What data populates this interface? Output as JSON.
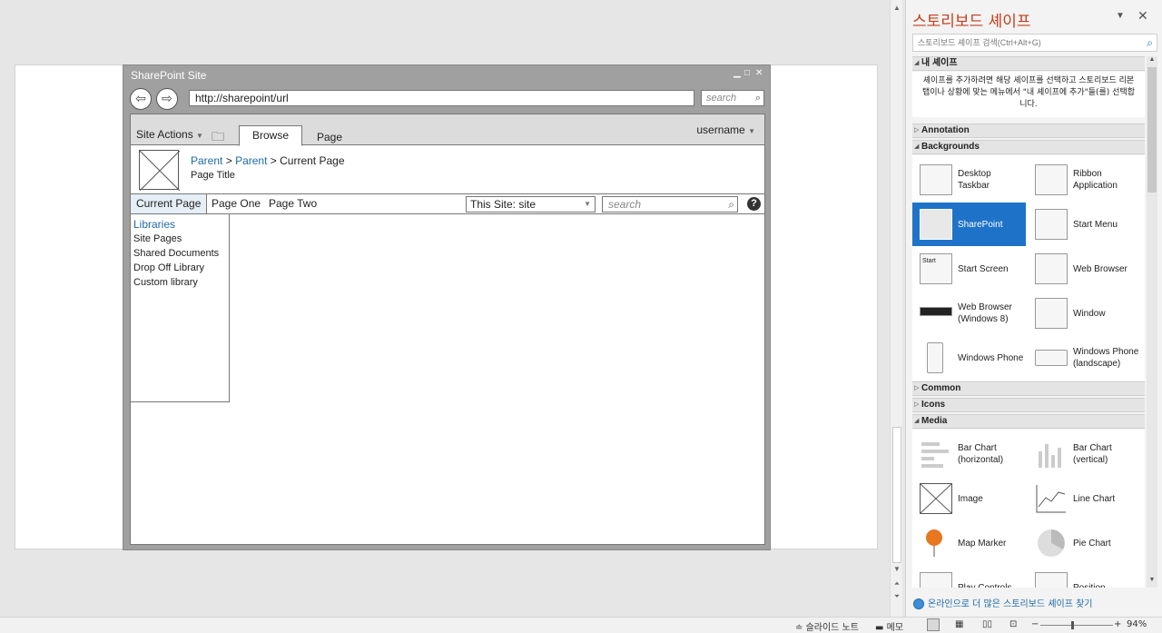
{
  "sharepoint": {
    "title": "SharePoint Site",
    "url": "http://sharepoint/url",
    "search_top_placeholder": "search",
    "site_actions": "Site Actions",
    "tab_browse": "Browse",
    "tab_page": "Page",
    "username": "username",
    "breadcrumb": {
      "parent1": "Parent",
      "parent2": "Parent",
      "sep": ">",
      "current": "Current Page"
    },
    "page_title": "Page Title",
    "nav": {
      "current": "Current Page",
      "one": "Page One",
      "two": "Page Two"
    },
    "scope": "This Site: site",
    "search_placeholder": "search",
    "quick_launch": {
      "heading": "Libraries",
      "items": [
        "Site Pages",
        "Shared Documents",
        "Drop Off Library",
        "Custom library"
      ]
    }
  },
  "pane": {
    "title": "스토리보드 셰이프",
    "search_placeholder": "스토리보드 셰이프 검색(Ctrl+Alt+G)",
    "my_shapes": {
      "header": "내 셰이프",
      "message": "셰이프를 추가하려면 해당 셰이프를 선택하고 스토리보드 리본 탭이나 상황에 맞는 메뉴에서 \"내 셰이프에 추가\"들(를) 선택합니다."
    },
    "sections": {
      "annotation": "Annotation",
      "backgrounds": "Backgrounds",
      "common": "Common",
      "icons": "Icons",
      "media": "Media"
    },
    "backgrounds": [
      "Desktop Taskbar",
      "Ribbon Application",
      "SharePoint",
      "Start Menu",
      "Start Screen",
      "Web Browser",
      "Web Browser (Windows 8)",
      "Window",
      "Windows Phone",
      "Windows Phone (landscape)"
    ],
    "media": [
      "Bar Chart (horizontal)",
      "Bar Chart (vertical)",
      "Image",
      "Line Chart",
      "Map Marker",
      "Pie Chart",
      "Play Controls",
      "Position"
    ],
    "start_icon_text": "Start",
    "footer_link": "온라인으로 더 많은 스토리보드 셰이프 찾기"
  },
  "status": {
    "notes": "슬라이드 노트",
    "comments": "메모",
    "zoom": "94%"
  }
}
